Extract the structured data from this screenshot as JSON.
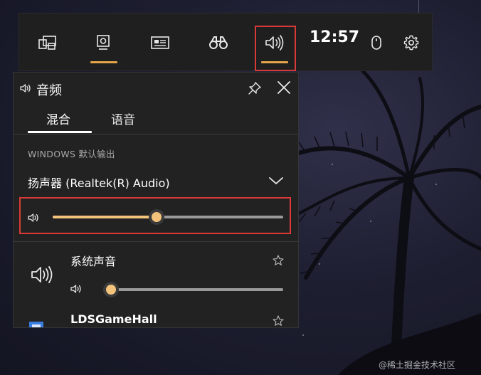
{
  "topbar": {
    "clock": "12:57",
    "buttons": [
      {
        "name": "widget-menu",
        "icon": "widget-icon"
      },
      {
        "name": "capture",
        "icon": "capture-icon"
      },
      {
        "name": "performance",
        "icon": "performance-icon"
      },
      {
        "name": "looking-for-group",
        "icon": "binoculars-icon"
      },
      {
        "name": "audio",
        "icon": "speaker-icon",
        "active": true
      },
      {
        "name": "mouse",
        "icon": "mouse-icon"
      },
      {
        "name": "settings",
        "icon": "gear-icon"
      }
    ],
    "accent_color": "#e2a54a",
    "highlight_color": "#d93a37"
  },
  "audio_panel": {
    "title": "音频",
    "tabs": [
      {
        "label": "混合",
        "selected": true
      },
      {
        "label": "语音",
        "selected": false
      }
    ],
    "section_label": "WINDOWS 默认输出",
    "output_device": "扬声器 (Realtek(R) Audio)",
    "master_volume": 0.45,
    "apps": [
      {
        "name": "系统声音",
        "volume": 0.0,
        "icon": "speaker-icon"
      },
      {
        "name": "LDSGameHall",
        "icon": "app-window-icon"
      }
    ],
    "slider_color": "#f3c37b"
  },
  "watermark": "@稀土掘金技术社区"
}
